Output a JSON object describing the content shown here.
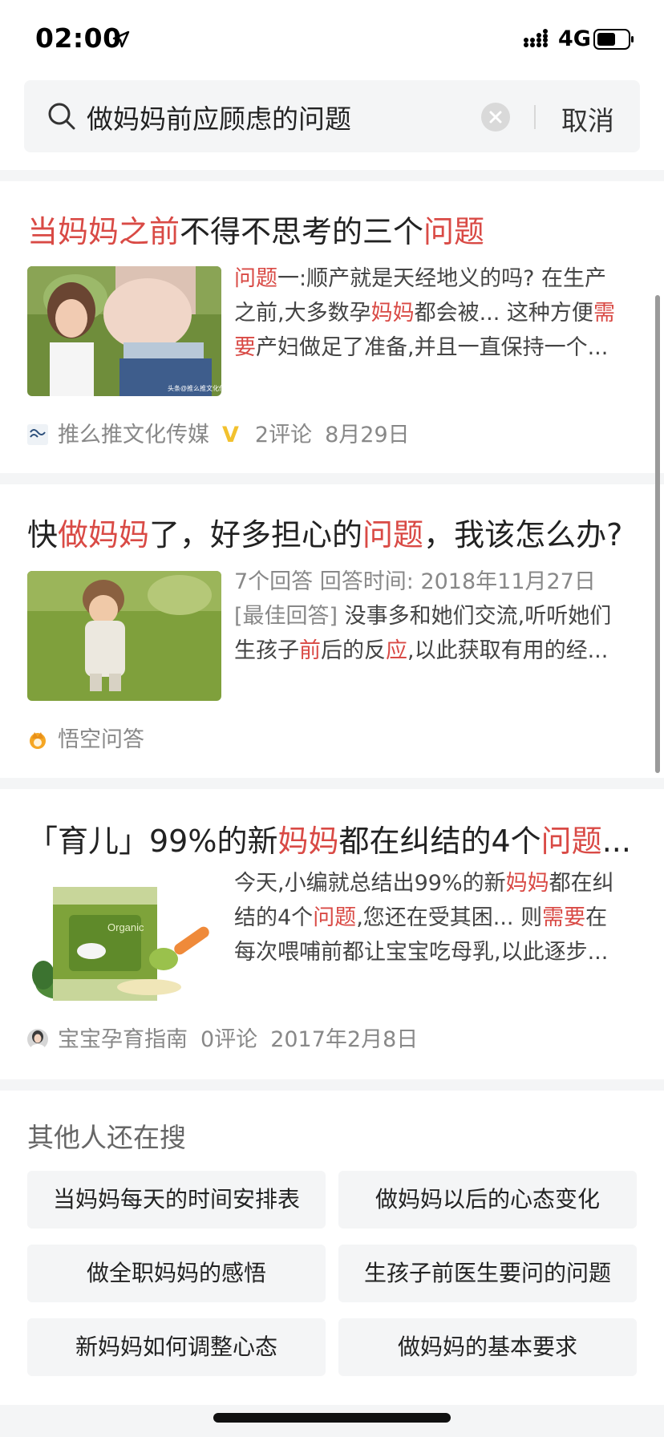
{
  "status_bar": {
    "time": "02:00",
    "network": "4G"
  },
  "search": {
    "query": "做妈妈前应顾虑的问题",
    "cancel_label": "取消"
  },
  "results": [
    {
      "title_parts": [
        {
          "text": "当妈妈之前",
          "hl": true
        },
        {
          "text": "不得不思考的三个",
          "hl": false
        },
        {
          "text": "问题",
          "hl": true
        }
      ],
      "snippet_lines": [
        [
          {
            "text": "问题",
            "hl": true
          },
          {
            "text": "一:顺产就是天经地义的吗? 在生产",
            "hl": false
          }
        ],
        [
          {
            "text": "之前,大多数孕",
            "hl": false
          },
          {
            "text": "妈妈",
            "hl": true
          },
          {
            "text": "都会被... 这种方便",
            "hl": false
          },
          {
            "text": "需",
            "hl": true
          }
        ],
        [
          {
            "text": "要",
            "hl": true
          },
          {
            "text": "产妇做足了准备,并且一直保持一个...",
            "hl": false
          }
        ]
      ],
      "source": "推么推文化传媒",
      "verified": "V",
      "comments": "2评论",
      "date": "8月29日",
      "thumb_caption": "头条@推么推文化传媒"
    },
    {
      "title_parts": [
        {
          "text": "快",
          "hl": false
        },
        {
          "text": "做妈妈",
          "hl": true
        },
        {
          "text": "了，好多担心的",
          "hl": false
        },
        {
          "text": "问题",
          "hl": true
        },
        {
          "text": "，我该怎么办?",
          "hl": false
        }
      ],
      "answer_info": "7个回答  回答时间: 2018年11月27日",
      "snippet_lines": [
        [
          {
            "text": "[最佳回答]",
            "hl": false,
            "grey": true
          },
          {
            "text": " 没事多和她们交流,听听她们",
            "hl": false
          }
        ],
        [
          {
            "text": "生孩子",
            "hl": false
          },
          {
            "text": "前",
            "hl": true
          },
          {
            "text": "后的反",
            "hl": false
          },
          {
            "text": "应",
            "hl": true
          },
          {
            "text": ",以此获取有用的经...",
            "hl": false
          }
        ]
      ],
      "source": "悟空问答"
    },
    {
      "title_parts": [
        {
          "text": "「育儿」99%的新",
          "hl": false
        },
        {
          "text": "妈妈",
          "hl": true
        },
        {
          "text": "都在纠结的4个",
          "hl": false
        },
        {
          "text": "问题",
          "hl": true
        },
        {
          "text": "...",
          "hl": false
        }
      ],
      "snippet_lines": [
        [
          {
            "text": "今天,小编就总结出99%的新",
            "hl": false
          },
          {
            "text": "妈妈",
            "hl": true
          },
          {
            "text": "都在纠",
            "hl": false
          }
        ],
        [
          {
            "text": "结的4个",
            "hl": false
          },
          {
            "text": "问题",
            "hl": true
          },
          {
            "text": ",您还在受其困... 则",
            "hl": false
          },
          {
            "text": "需要",
            "hl": true
          },
          {
            "text": "在",
            "hl": false
          }
        ],
        [
          {
            "text": "每次喂哺前都让宝宝吃母乳,以此逐步...",
            "hl": false
          }
        ]
      ],
      "source": "宝宝孕育指南",
      "comments": "0评论",
      "date": "2017年2月8日",
      "thumb_label": "Organic"
    }
  ],
  "related": {
    "title": "其他人还在搜",
    "items": [
      "当妈妈每天的时间安排表",
      "做妈妈以后的心态变化",
      "做全职妈妈的感悟",
      "生孩子前医生要问的问题",
      "新妈妈如何调整心态",
      "做妈妈的基本要求"
    ]
  },
  "colors": {
    "highlight": "#d94a45",
    "chip_bg": "#f4f5f6",
    "meta": "#888888"
  }
}
